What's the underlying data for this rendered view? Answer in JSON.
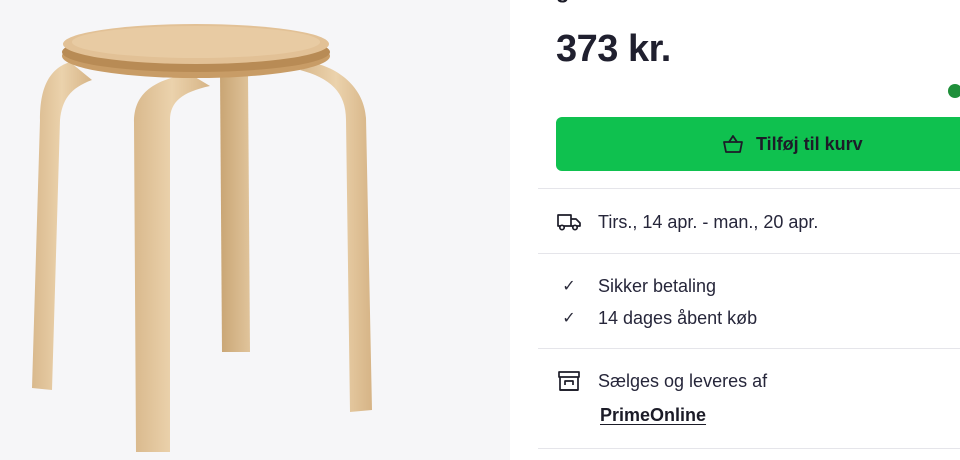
{
  "product": {
    "title_fragment": "g",
    "price": "373 kr."
  },
  "colors": {
    "accent": "#0fc14f",
    "stock": "#1f8f3a"
  },
  "cart_button": {
    "label": "Tilføj til kurv",
    "icon": "basket-icon"
  },
  "delivery": {
    "icon": "truck-icon",
    "text": "Tirs., 14 apr. - man., 20 apr."
  },
  "benefits": [
    {
      "icon": "check-icon",
      "text": "Sikker betaling"
    },
    {
      "icon": "check-icon",
      "text": "14 dages åbent køb"
    }
  ],
  "seller": {
    "icon": "store-icon",
    "label": "Sælges og leveres af",
    "name": "PrimeOnline"
  }
}
